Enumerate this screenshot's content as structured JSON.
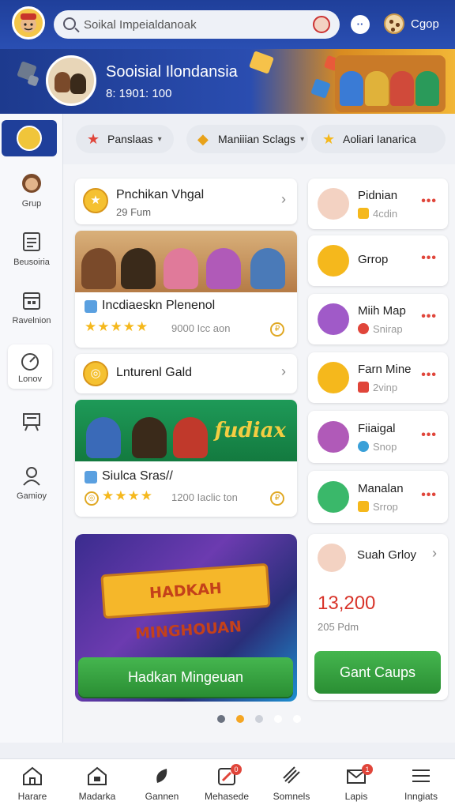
{
  "header": {
    "search_placeholder": "Soikal Impeialdanoak",
    "label": "Cgop",
    "msg_icon": "message-bubble-icon",
    "cookie_icon": "cookie-icon"
  },
  "hero": {
    "title": "Sooisial Ilondansia",
    "subtitle": "8: 1901: 100"
  },
  "sidebar": {
    "items": [
      {
        "label": "Grup",
        "icon": "avatar-icon"
      },
      {
        "label": "Beusoiria",
        "icon": "document-icon"
      },
      {
        "label": "Ravelnion",
        "icon": "calendar-icon"
      },
      {
        "label": "Lonov",
        "icon": "gauge-icon"
      },
      {
        "label": "",
        "icon": "board-icon"
      },
      {
        "label": "Gamioy",
        "icon": "person-icon"
      }
    ]
  },
  "chips": [
    {
      "label": "Panslaas",
      "icon": "star-icon"
    },
    {
      "label": "Maniiian Sclags",
      "icon": "gem-icon"
    },
    {
      "label": "Aoliari Ianarica",
      "icon": "star-icon"
    }
  ],
  "left_cards": {
    "c1": {
      "title": "Pnchikan Vhgal",
      "sub": "29 Fum"
    },
    "c2": {
      "title": "Incdiaeskn Plenenol",
      "score": "9000 Icc aon",
      "stars": "★★★★★"
    },
    "c3": {
      "title": "Lnturenl Gald"
    },
    "c4": {
      "title": "Siulca Sras//",
      "score": "1200 Iaclic ton",
      "stars": "★★★★",
      "script": "fudiax"
    }
  },
  "promo": {
    "banner": "HADKAH MINGHOUAN",
    "cta": "Hadkan Mingeuan"
  },
  "right_cards": [
    {
      "title": "Pidnian",
      "sub": "4cdin"
    },
    {
      "title": "Grrop",
      "sub": ""
    },
    {
      "title": "Miih Map",
      "sub": "Snirap"
    },
    {
      "title": "Farn Mine",
      "sub": "2vinp"
    },
    {
      "title": "Fiiaigal",
      "sub": "Snop"
    },
    {
      "title": "Manalan",
      "sub": "Srrop"
    }
  ],
  "suah": {
    "title": "Suah Grloy",
    "value": "13,200",
    "sub": "205 Pdm",
    "cta": "Gant Caups"
  },
  "pager": {
    "count": 5,
    "active": 1
  },
  "bottom_nav": [
    {
      "label": "Harare",
      "icon": "home-icon"
    },
    {
      "label": "Madarka",
      "icon": "house-icon"
    },
    {
      "label": "Gannen",
      "icon": "leaf-icon"
    },
    {
      "label": "Mehasede",
      "icon": "pencil-box-icon",
      "badge": "0"
    },
    {
      "label": "Somnels",
      "icon": "rocket-icon"
    },
    {
      "label": "Lapis",
      "icon": "mail-icon",
      "badge": "1"
    },
    {
      "label": "Inngiats",
      "icon": "menu-icon"
    }
  ],
  "colors": {
    "brand": "#1f3f9a",
    "accent": "#f5b81c",
    "danger": "#e0453a",
    "success": "#2a8e33"
  }
}
